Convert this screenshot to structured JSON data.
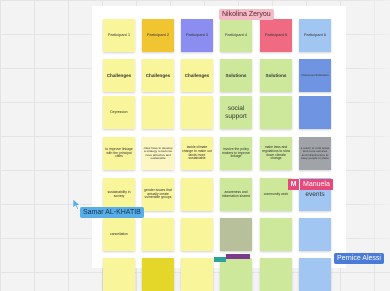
{
  "board": {
    "rows": [
      [
        {
          "text": "Participant 1",
          "color": "#f9f59b"
        },
        {
          "text": "Participant 2",
          "color": "#f1c532"
        },
        {
          "text": "Participant 3",
          "color": "#8b8ef0"
        },
        {
          "text": "Participant 4",
          "color": "#cde79b"
        },
        {
          "text": "Participant 5",
          "color": "#f06a82"
        },
        {
          "text": "Participant 6",
          "color": "#a2c6f2"
        }
      ],
      [
        {
          "text": "Challenges",
          "color": "#f9f59b"
        },
        {
          "text": "Challenges",
          "color": "#f9f59b"
        },
        {
          "text": "Challenges",
          "color": "#f9f59b"
        },
        {
          "text": "Solutions",
          "color": "#cde79b"
        },
        {
          "text": "Solutions",
          "color": "#cde79b"
        },
        {
          "text": "Outcomes/Indicators",
          "color": "#6f95e2"
        }
      ],
      [
        {
          "text": "Depression",
          "color": "#f9f59b"
        },
        {
          "text": "",
          "color": "#f9f59b"
        },
        {
          "text": "",
          "color": "#f9f59b"
        },
        {
          "text": "social support",
          "color": "#cde79b"
        },
        {
          "text": "",
          "color": "#cde79b"
        },
        {
          "text": "",
          "color": "#6f95e2"
        }
      ],
      [
        {
          "text": "to improve linkage with the principal cities",
          "color": "#f9f59b"
        },
        {
          "text": "cities have to develop a strategy to become more attractive and sustainable",
          "color": "#fcf7c2"
        },
        {
          "text": "tackle climate change to make our lands more sustainable",
          "color": "#f9f59b"
        },
        {
          "text": "involve the policy makers to improve linkage",
          "color": "#cde79b"
        },
        {
          "text": "make laws and regulations to slow down climate change",
          "color": "#cde79b"
        },
        {
          "text": "a return to rural areas and more services and infrastructure to keep people in place",
          "color": "#a0a4a8"
        }
      ],
      [
        {
          "text": "sustainability in society",
          "color": "#f9f59b"
        },
        {
          "text": "gender issues that actually create vulnerable groups",
          "color": "#f9f59b"
        },
        {
          "text": "",
          "color": "#f9f59b"
        },
        {
          "text": "awareness and information shared",
          "color": "#cde79b"
        },
        {
          "text": "community work",
          "color": "#cde79b"
        },
        {
          "text": "events",
          "color": "#a2c6f2"
        }
      ],
      [
        {
          "text": "cancellation",
          "color": "#f9f59b"
        },
        {
          "text": "",
          "color": "#f9f59b"
        },
        {
          "text": "",
          "color": "#f9f59b"
        },
        {
          "text": "",
          "color": "#b7c09a"
        },
        {
          "text": "",
          "color": "#cde79b"
        },
        {
          "text": "",
          "color": "#a2c6f2"
        }
      ],
      [
        {
          "text": "",
          "color": "#f9f59b"
        },
        {
          "text": "",
          "color": "#e4d72a"
        },
        {
          "text": "",
          "color": "#f9f59b"
        },
        {
          "text": "",
          "color": "#cde79b"
        },
        {
          "text": "",
          "color": "#cde79b"
        },
        {
          "text": "",
          "color": "#a2c6f2"
        }
      ]
    ]
  },
  "collaborators": {
    "top": {
      "name": "Nikolina Zeryou",
      "color": "#f4bcc7"
    },
    "left": {
      "name": "Samar AL-KHATIB",
      "color": "#5aaee8"
    },
    "badge": {
      "initial": "M",
      "name": "Manuela",
      "color": "#e6497a"
    },
    "bottom_right": {
      "name": "Pernice Alessi",
      "color": "#4a7bd8"
    }
  }
}
